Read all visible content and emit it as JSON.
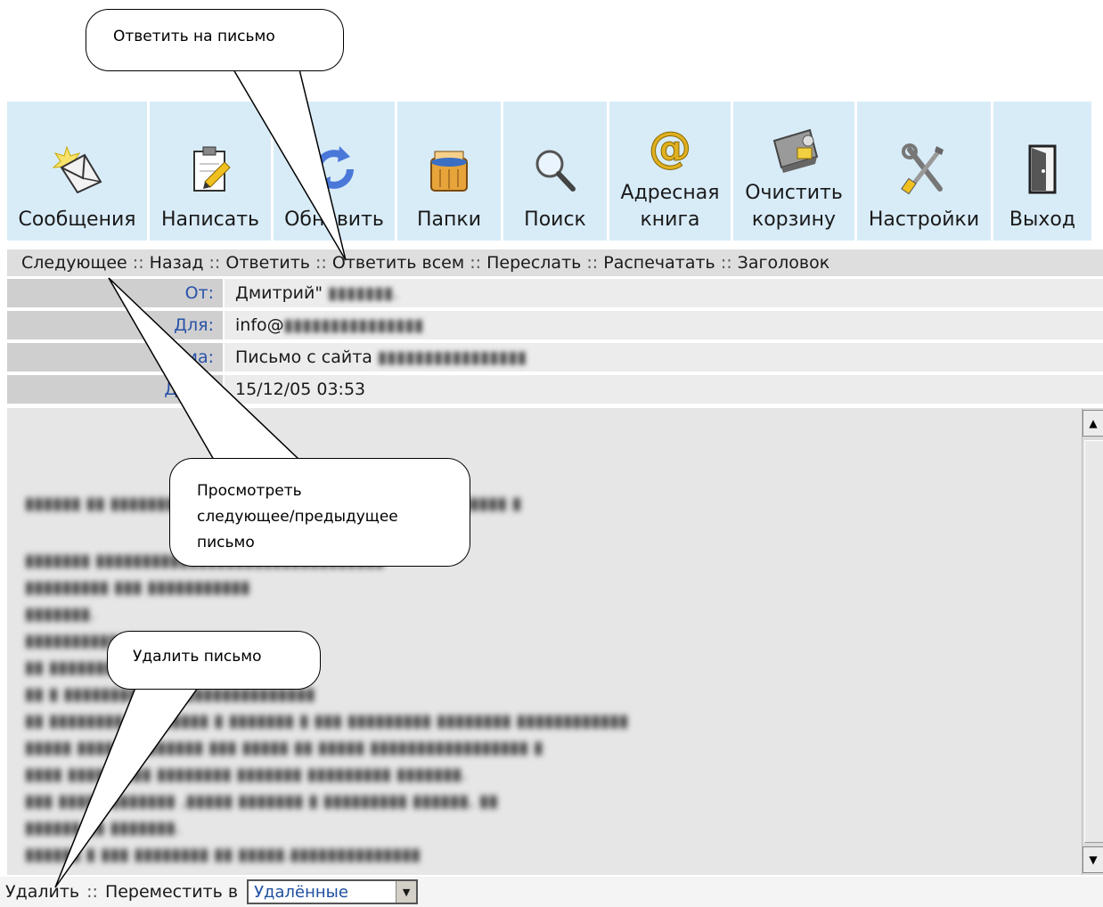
{
  "toolbar": {
    "buttons": [
      {
        "label": "Сообщения",
        "icon": "messages-icon"
      },
      {
        "label": "Написать",
        "icon": "compose-icon"
      },
      {
        "label": "Обновить",
        "icon": "refresh-icon"
      },
      {
        "label": "Папки",
        "icon": "folders-icon"
      },
      {
        "label": "Поиск",
        "icon": "search-icon"
      },
      {
        "label": "Адресная\nкнига",
        "icon": "address-book-icon"
      },
      {
        "label": "Очистить\nкорзину",
        "icon": "empty-trash-icon"
      },
      {
        "label": "Настройки",
        "icon": "settings-icon"
      },
      {
        "label": "Выход",
        "icon": "exit-door-icon"
      }
    ]
  },
  "actions": {
    "next": "Следующее",
    "back": "Назад",
    "reply": "Ответить",
    "reply_all": "Ответить всем",
    "forward": "Переслать",
    "print": "Распечатать",
    "headers": "Заголовок",
    "separator": "::"
  },
  "headers": {
    "from_label": "От:",
    "from_value": "Дмитрий\"",
    "to_label": "Для:",
    "to_value": "info@",
    "subject_label": "Тема:",
    "subject_value": "Письмо с сайта",
    "date_label": "Дата:",
    "date_value": "15/12/05 03:53"
  },
  "footer": {
    "delete": "Удалить",
    "separator": "::",
    "move_to": "Переместить в",
    "folder_selected": "Удалённые"
  },
  "callouts": {
    "reply": "Ответить на письмо",
    "navigate": "Просмотреть\nследующее/предыдущее\nписьмо",
    "delete": "Удалить письмо"
  },
  "colors": {
    "toolbar_bg": "#d8ecf8",
    "label_blue": "#2a52a8",
    "row_bg": "#ececec",
    "action_bg": "#dedede"
  }
}
